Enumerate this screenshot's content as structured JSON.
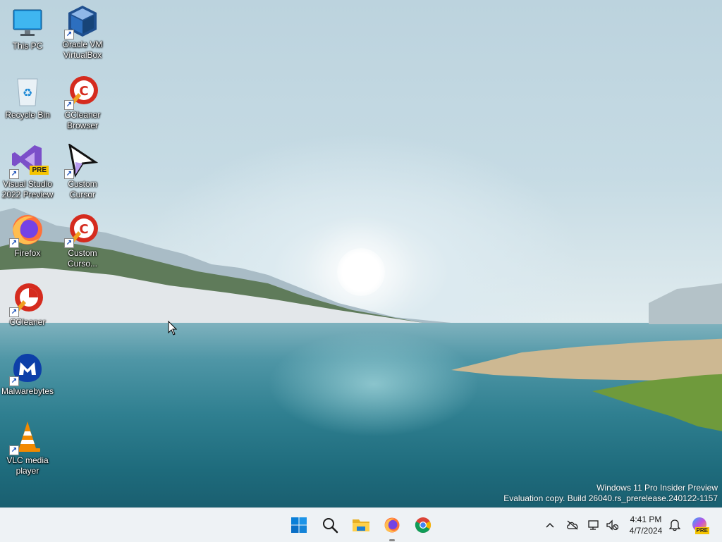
{
  "desktop": {
    "icons": [
      {
        "label": "This PC",
        "icon": "computer-monitor-icon"
      },
      {
        "label": "Oracle VM VirtualBox",
        "icon": "virtualbox-icon"
      },
      {
        "label": "Recycle Bin",
        "icon": "recycle-bin-icon"
      },
      {
        "label": "CCleaner Browser",
        "icon": "ccleaner-browser-icon"
      },
      {
        "label": "Visual Studio 2022 Preview",
        "icon": "visual-studio-preview-icon",
        "badge": "PRE"
      },
      {
        "label": "Custom Cursor",
        "icon": "custom-cursor-icon"
      },
      {
        "label": "Firefox",
        "icon": "firefox-icon"
      },
      {
        "label": "Custom Curso...",
        "icon": "ccleaner-cursor-icon"
      },
      {
        "label": "CCleaner",
        "icon": "ccleaner-icon"
      },
      {
        "label": "Malwarebytes",
        "icon": "malwarebytes-icon"
      },
      {
        "label": "VLC media player",
        "icon": "vlc-cone-icon"
      }
    ]
  },
  "watermark": {
    "line1": "Windows 11 Pro Insider Preview",
    "line2": "Evaluation copy. Build 26040.rs_prerelease.240122-1157"
  },
  "taskbar": {
    "apps": [
      {
        "name": "Start",
        "icon": "windows-start-icon"
      },
      {
        "name": "Search",
        "icon": "search-icon"
      },
      {
        "name": "File Explorer",
        "icon": "folder-icon"
      },
      {
        "name": "Firefox",
        "icon": "firefox-icon",
        "running": true
      },
      {
        "name": "Chrome",
        "icon": "chrome-icon"
      }
    ],
    "tray": {
      "icons": [
        "chevron-up-icon",
        "onedrive-offline-icon",
        "network-icon",
        "volume-muted-icon",
        "bell-icon",
        "copilot-preview-icon"
      ],
      "copilot_badge": "PRE"
    },
    "clock": {
      "time": "4:41 PM",
      "date": "4/7/2024"
    }
  },
  "colors": {
    "taskbar_bg": "#eef2f5",
    "accent": "#0067c0",
    "label_text": "#ffffff"
  }
}
